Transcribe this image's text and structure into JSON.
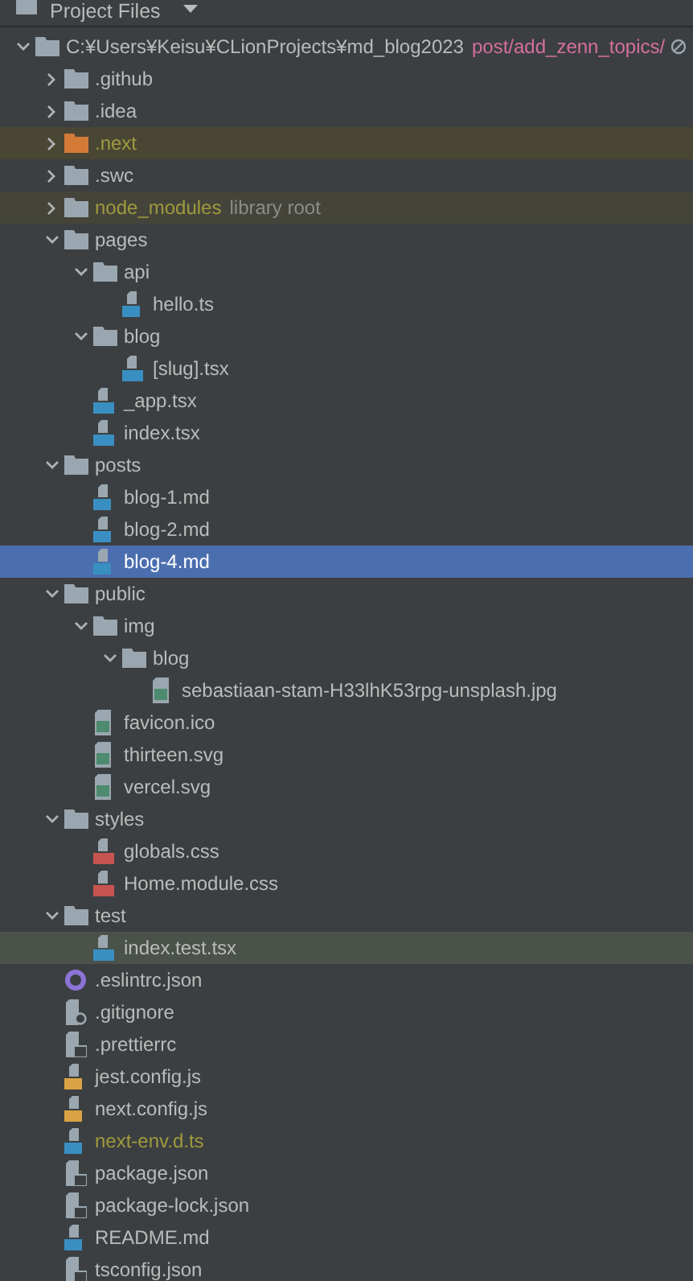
{
  "header": {
    "title": "Project Files"
  },
  "tree": [
    {
      "name": "C:¥Users¥Keisu¥CLionProjects¥md_blog2023",
      "branch": "post/add_zenn_topics/",
      "kind": "folder",
      "expanded": true,
      "selected": false,
      "excluded": false,
      "ignored": false,
      "test": false,
      "children": [
        {
          "name": ".github",
          "kind": "folder",
          "expanded": false,
          "selected": false,
          "excluded": false,
          "ignored": false,
          "test": false
        },
        {
          "name": ".idea",
          "kind": "folder",
          "expanded": false,
          "selected": false,
          "excluded": false,
          "ignored": false,
          "test": false
        },
        {
          "name": ".next",
          "kind": "folder",
          "expanded": false,
          "selected": false,
          "excluded": true,
          "ignored": false,
          "test": false
        },
        {
          "name": ".swc",
          "kind": "folder",
          "expanded": false,
          "selected": false,
          "excluded": false,
          "ignored": false,
          "test": false
        },
        {
          "name": "node_modules",
          "suffix": "library root",
          "kind": "folder",
          "expanded": false,
          "selected": false,
          "excluded": true,
          "ignored": false,
          "test": false
        },
        {
          "name": "pages",
          "kind": "folder",
          "expanded": true,
          "selected": false,
          "excluded": false,
          "ignored": false,
          "test": false,
          "children": [
            {
              "name": "api",
              "kind": "folder",
              "expanded": true,
              "selected": false,
              "excluded": false,
              "ignored": false,
              "test": false,
              "children": [
                {
                  "name": "hello.ts",
                  "kind": "ts",
                  "selected": false,
                  "excluded": false,
                  "ignored": false,
                  "test": false
                }
              ]
            },
            {
              "name": "blog",
              "kind": "folder",
              "expanded": true,
              "selected": false,
              "excluded": false,
              "ignored": false,
              "test": false,
              "children": [
                {
                  "name": "[slug].tsx",
                  "kind": "tsx",
                  "selected": false,
                  "excluded": false,
                  "ignored": false,
                  "test": false
                }
              ]
            },
            {
              "name": "_app.tsx",
              "kind": "tsx",
              "selected": false,
              "excluded": false,
              "ignored": false,
              "test": false
            },
            {
              "name": "index.tsx",
              "kind": "tsx",
              "selected": false,
              "excluded": false,
              "ignored": false,
              "test": false
            }
          ]
        },
        {
          "name": "posts",
          "kind": "folder",
          "expanded": true,
          "selected": false,
          "excluded": false,
          "ignored": false,
          "test": false,
          "children": [
            {
              "name": "blog-1.md",
              "kind": "md",
              "selected": false,
              "excluded": false,
              "ignored": false,
              "test": false
            },
            {
              "name": "blog-2.md",
              "kind": "md",
              "selected": false,
              "excluded": false,
              "ignored": false,
              "test": false
            },
            {
              "name": "blog-4.md",
              "kind": "md",
              "selected": true,
              "excluded": false,
              "ignored": false,
              "test": false
            }
          ]
        },
        {
          "name": "public",
          "kind": "folder",
          "expanded": true,
          "selected": false,
          "excluded": false,
          "ignored": false,
          "test": false,
          "children": [
            {
              "name": "img",
              "kind": "folder",
              "expanded": true,
              "selected": false,
              "excluded": false,
              "ignored": false,
              "test": false,
              "children": [
                {
                  "name": "blog",
                  "kind": "folder",
                  "expanded": true,
                  "selected": false,
                  "excluded": false,
                  "ignored": false,
                  "test": false,
                  "children": [
                    {
                      "name": "sebastiaan-stam-H33lhK53rpg-unsplash.jpg",
                      "kind": "image",
                      "selected": false,
                      "excluded": false,
                      "ignored": false,
                      "test": false
                    }
                  ]
                }
              ]
            },
            {
              "name": "favicon.ico",
              "kind": "image",
              "selected": false,
              "excluded": false,
              "ignored": false,
              "test": false
            },
            {
              "name": "thirteen.svg",
              "kind": "image",
              "selected": false,
              "excluded": false,
              "ignored": false,
              "test": false
            },
            {
              "name": "vercel.svg",
              "kind": "image",
              "selected": false,
              "excluded": false,
              "ignored": false,
              "test": false
            }
          ]
        },
        {
          "name": "styles",
          "kind": "folder",
          "expanded": true,
          "selected": false,
          "excluded": false,
          "ignored": false,
          "test": false,
          "children": [
            {
              "name": "globals.css",
              "kind": "css",
              "selected": false,
              "excluded": false,
              "ignored": false,
              "test": false
            },
            {
              "name": "Home.module.css",
              "kind": "css",
              "selected": false,
              "excluded": false,
              "ignored": false,
              "test": false
            }
          ]
        },
        {
          "name": "test",
          "kind": "folder",
          "expanded": true,
          "selected": false,
          "excluded": false,
          "ignored": false,
          "test": false,
          "children": [
            {
              "name": "index.test.tsx",
              "kind": "tsx",
              "selected": false,
              "excluded": false,
              "ignored": false,
              "test": true
            }
          ]
        },
        {
          "name": ".eslintrc.json",
          "kind": "eslint",
          "selected": false,
          "excluded": false,
          "ignored": false,
          "test": false
        },
        {
          "name": ".gitignore",
          "kind": "ignore",
          "selected": false,
          "excluded": false,
          "ignored": false,
          "test": false
        },
        {
          "name": ".prettierrc",
          "kind": "config",
          "selected": false,
          "excluded": false,
          "ignored": false,
          "test": false
        },
        {
          "name": "jest.config.js",
          "kind": "js",
          "selected": false,
          "excluded": false,
          "ignored": false,
          "test": false
        },
        {
          "name": "next.config.js",
          "kind": "js",
          "selected": false,
          "excluded": false,
          "ignored": false,
          "test": false
        },
        {
          "name": "next-env.d.ts",
          "kind": "ts",
          "selected": false,
          "excluded": false,
          "ignored": true,
          "test": false
        },
        {
          "name": "package.json",
          "kind": "config",
          "selected": false,
          "excluded": false,
          "ignored": false,
          "test": false
        },
        {
          "name": "package-lock.json",
          "kind": "config",
          "selected": false,
          "excluded": false,
          "ignored": false,
          "test": false
        },
        {
          "name": "README.md",
          "kind": "md",
          "selected": false,
          "excluded": false,
          "ignored": false,
          "test": false
        },
        {
          "name": "tsconfig.json",
          "kind": "config",
          "selected": false,
          "excluded": false,
          "ignored": false,
          "test": false
        }
      ]
    }
  ]
}
